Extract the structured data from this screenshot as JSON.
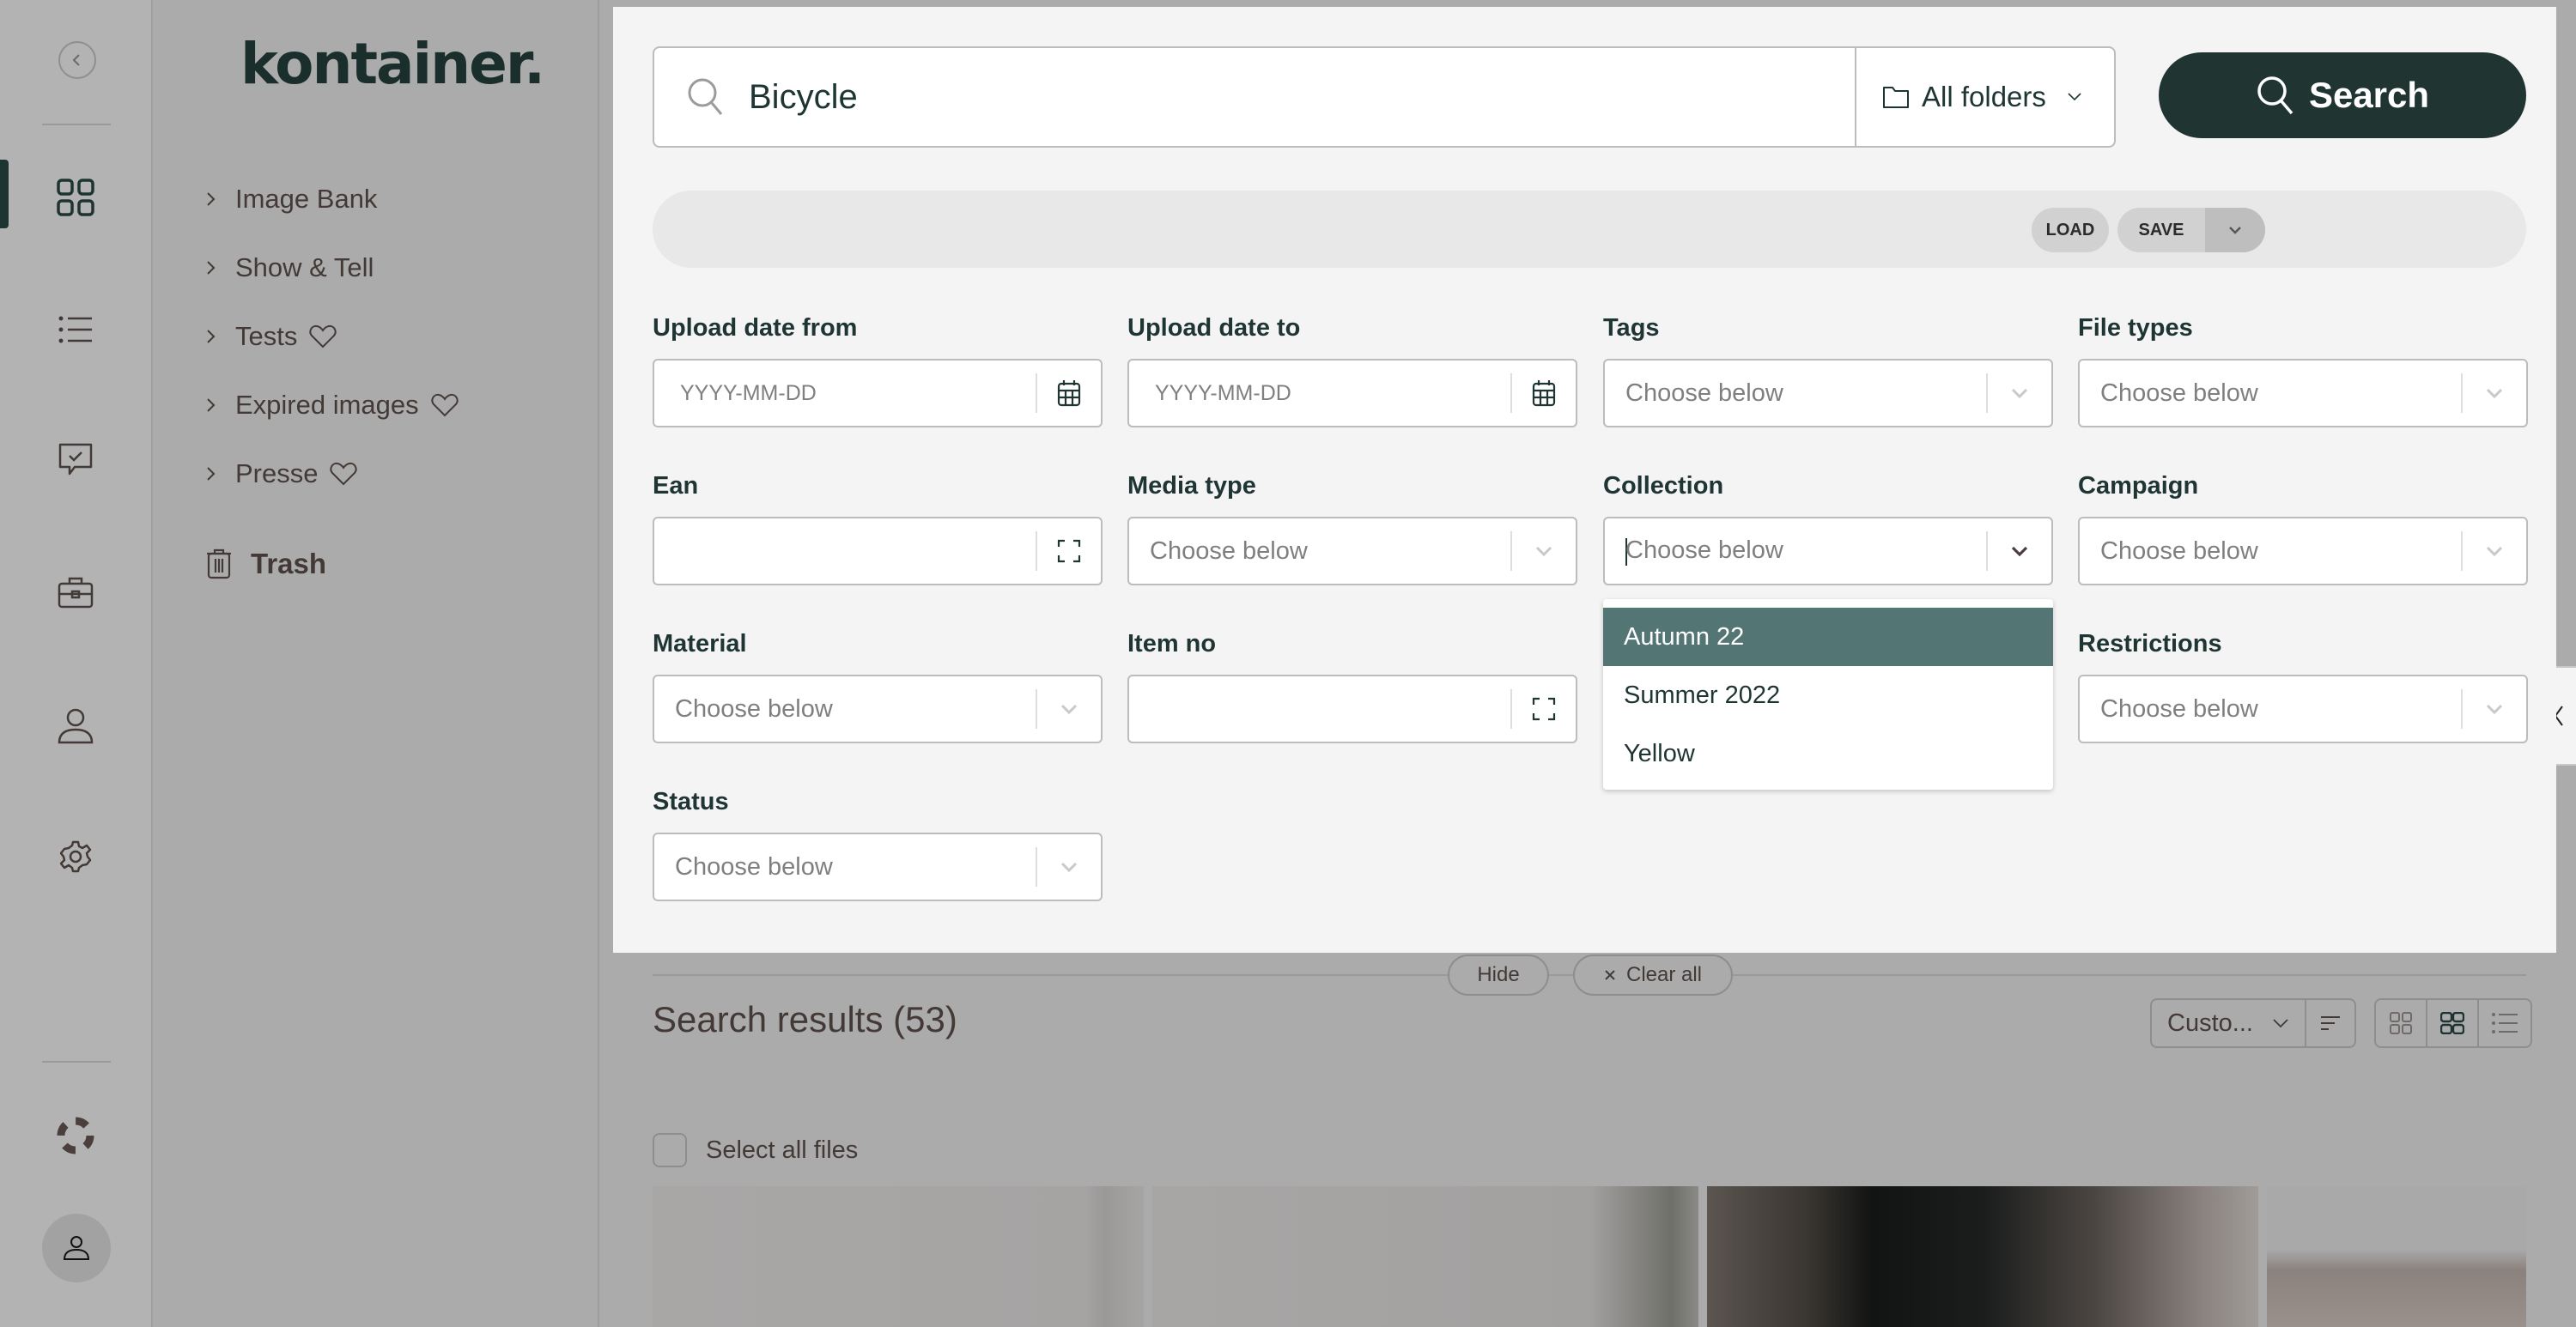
{
  "app": {
    "logo": "kontainer."
  },
  "rail": {
    "items": [
      {
        "icon": "grid-icon",
        "active": true
      },
      {
        "icon": "list-icon",
        "active": false
      },
      {
        "icon": "approval-chat-icon",
        "active": false
      },
      {
        "icon": "briefcase-icon",
        "active": false
      },
      {
        "icon": "user-icon",
        "active": false
      },
      {
        "icon": "gear-icon",
        "active": false
      }
    ],
    "bottom": [
      {
        "icon": "help-lifebuoy-icon"
      },
      {
        "icon": "profile-avatar-icon"
      }
    ]
  },
  "folders": {
    "items": [
      {
        "label": "Image Bank",
        "favorite": false
      },
      {
        "label": "Show & Tell",
        "favorite": false
      },
      {
        "label": "Tests",
        "favorite": true
      },
      {
        "label": "Expired images",
        "favorite": true
      },
      {
        "label": "Presse",
        "favorite": true
      }
    ],
    "trash_label": "Trash"
  },
  "search": {
    "query": "Bicycle",
    "folder_scope": "All folders",
    "button_label": "Search"
  },
  "filter_bar": {
    "load_label": "LOAD",
    "save_label": "SAVE"
  },
  "filters": {
    "upload_date_from": {
      "label": "Upload date from",
      "placeholder": "YYYY-MM-DD"
    },
    "upload_date_to": {
      "label": "Upload date to",
      "placeholder": "YYYY-MM-DD"
    },
    "tags": {
      "label": "Tags",
      "placeholder": "Choose below"
    },
    "file_types": {
      "label": "File types",
      "placeholder": "Choose below"
    },
    "ean": {
      "label": "Ean",
      "value": ""
    },
    "media_type": {
      "label": "Media type",
      "placeholder": "Choose below"
    },
    "collection": {
      "label": "Collection",
      "placeholder": "Choose below",
      "open": true,
      "options": [
        "Autumn 22",
        "Summer 2022",
        "Yellow"
      ],
      "highlighted": "Autumn 22"
    },
    "campaign": {
      "label": "Campaign",
      "placeholder": "Choose below"
    },
    "material": {
      "label": "Material",
      "placeholder": "Choose below"
    },
    "item_no": {
      "label": "Item no",
      "value": ""
    },
    "restrictions": {
      "label": "Restrictions",
      "placeholder": "Choose below"
    },
    "status": {
      "label": "Status",
      "placeholder": "Choose below"
    }
  },
  "results": {
    "hide_label": "Hide",
    "clear_all_label": "Clear all",
    "title": "Search results (53)",
    "sort_value": "Custo...",
    "select_all_label": "Select all files",
    "view_mode": "medium-grid"
  },
  "colors": {
    "brand_dark": "#203532",
    "highlight": "#537675",
    "panel_bg": "#f4f4f4"
  }
}
